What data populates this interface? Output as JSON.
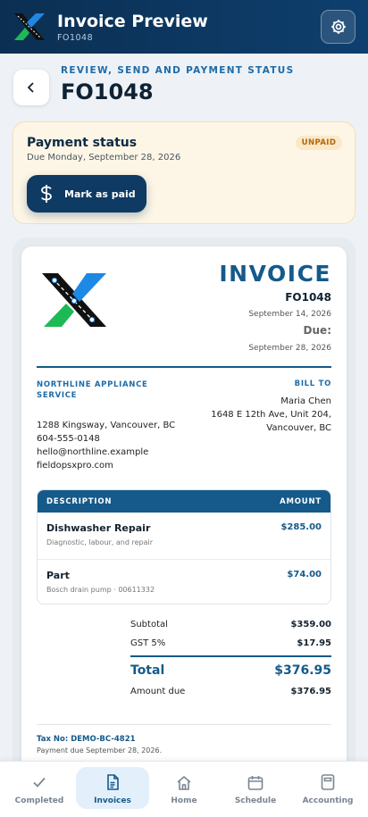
{
  "header": {
    "title": "Invoice Preview",
    "subtitle": "FO1048",
    "accent": "#0e3f6e"
  },
  "page": {
    "eyebrow": "REVIEW, SEND AND PAYMENT STATUS",
    "title": "FO1048"
  },
  "payment": {
    "title": "Payment status",
    "due": "Due Monday, September 28, 2026",
    "badge": "UNPAID",
    "button_label": "Mark as paid",
    "button_icon": "dollar-icon"
  },
  "invoice": {
    "heading": "INVOICE",
    "number": "FO1048",
    "date": "September 14, 2026",
    "due_label": "Due:",
    "due_date": "September 28, 2026",
    "from": {
      "name": "NORTHLINE APPLIANCE SERVICE",
      "lines": [
        "1288 Kingsway, Vancouver, BC",
        "604-555-0148",
        "hello@northline.example",
        "fieldopsxpro.com"
      ]
    },
    "bill_to": {
      "label": "BILL TO",
      "lines": [
        "Maria Chen",
        "1648 E 12th Ave, Unit 204,",
        "Vancouver, BC"
      ]
    },
    "items_header": {
      "description": "DESCRIPTION",
      "amount": "AMOUNT"
    },
    "items": [
      {
        "name": "Dishwasher Repair",
        "desc": "Diagnostic, labour, and repair",
        "amount": "$285.00"
      },
      {
        "name": "Part",
        "desc": "Bosch drain pump · 00611332",
        "amount": "$74.00"
      }
    ],
    "totals": {
      "subtotal_label": "Subtotal",
      "subtotal": "$359.00",
      "gst_label": "GST 5%",
      "gst": "$17.95",
      "total_label": "Total",
      "total": "$376.95",
      "amount_due_label": "Amount due",
      "amount_due": "$376.95"
    },
    "tax_no": "Tax No: DEMO-BC-4821",
    "payment_note": "Payment due September 28, 2026."
  },
  "nav": {
    "items": [
      {
        "label": "Completed",
        "icon": "check-icon"
      },
      {
        "label": "Invoices",
        "icon": "document-icon",
        "active": true
      },
      {
        "label": "Home",
        "icon": "home-icon"
      },
      {
        "label": "Schedule",
        "icon": "calendar-icon"
      },
      {
        "label": "Accounting",
        "icon": "calculator-icon"
      }
    ]
  }
}
